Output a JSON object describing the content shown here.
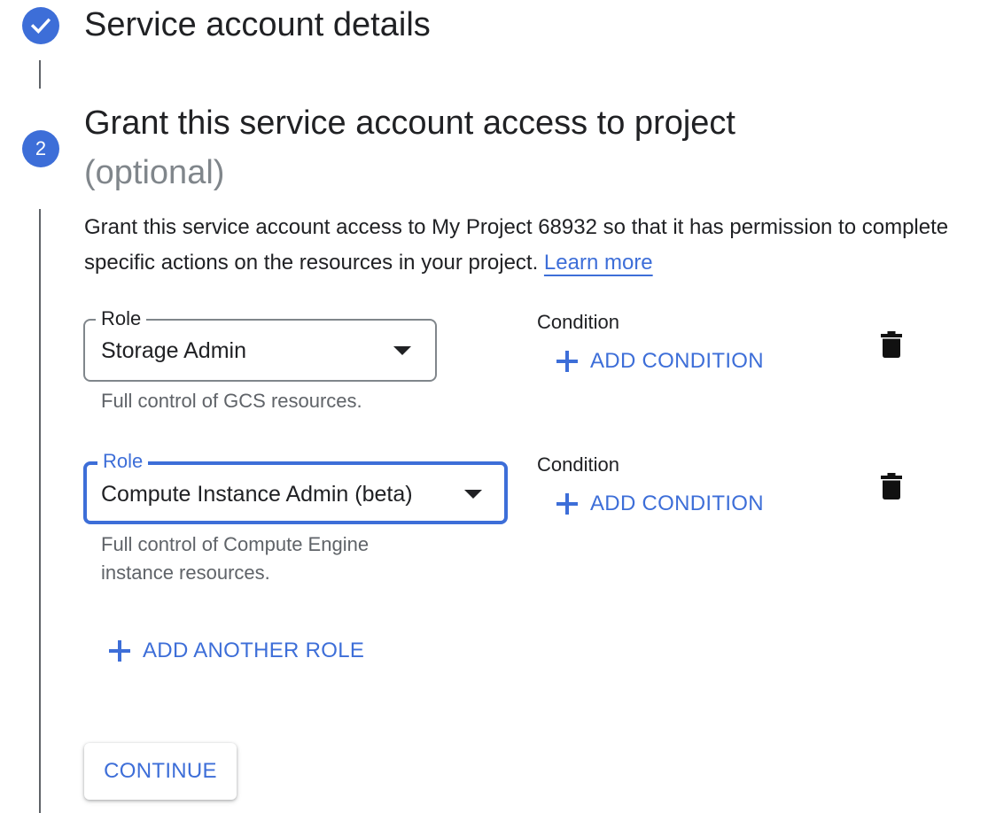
{
  "step1": {
    "title": "Service account details",
    "status": "completed"
  },
  "step2": {
    "number": "2",
    "title": "Grant this service account access to project",
    "optional": "(optional)",
    "description_prefix": "Grant this service account access to My Project 68932 so that it has permission to complete specific actions on the resources in your project. ",
    "learn_more": "Learn more"
  },
  "roles": [
    {
      "label": "Role",
      "value": "Storage Admin",
      "helper": "Full control of GCS resources.",
      "condition_label": "Condition",
      "add_condition": "ADD CONDITION",
      "focused": false
    },
    {
      "label": "Role",
      "value": "Compute Instance Admin (beta)",
      "helper": "Full control of Compute Engine instance resources.",
      "condition_label": "Condition",
      "add_condition": "ADD CONDITION",
      "focused": true
    }
  ],
  "add_another_role": "ADD ANOTHER ROLE",
  "continue_label": "CONTINUE",
  "icons": {
    "step_done": "check-icon",
    "dropdown": "caret-down-icon",
    "add": "plus-icon",
    "delete": "trash-icon"
  },
  "colors": {
    "accent": "#3d6ed8",
    "text": "#202124",
    "muted": "#5f6368",
    "optional": "#80868b"
  }
}
